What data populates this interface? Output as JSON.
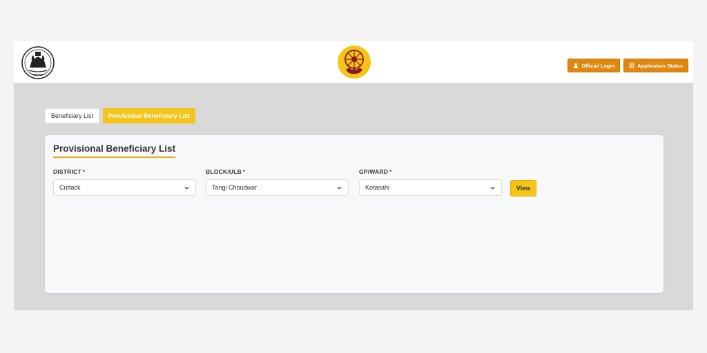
{
  "header": {
    "official_login_label": "Official Login",
    "application_status_label": "Application Status"
  },
  "tabs": [
    {
      "label": "Beneficiary List",
      "active": false
    },
    {
      "label": "Provisional Beneficiary List",
      "active": true
    }
  ],
  "card": {
    "title": "Provisional Beneficiary List",
    "fields": [
      {
        "label": "DISTRICT",
        "value": "Cuttack"
      },
      {
        "label": "BLOCK/ULB",
        "value": "Tangi Choudwar"
      },
      {
        "label": "GP/WARD",
        "value": "Kotasahi"
      }
    ],
    "required_mark": "*",
    "view_label": "View"
  },
  "colors": {
    "accent_orange": "#e0870f",
    "accent_yellow": "#f5c417",
    "page_bg": "#d9d9d9"
  },
  "icons": [
    "odisha-emblem-icon",
    "subhadra-logo-icon",
    "user-icon",
    "document-icon",
    "chevron-down-icon"
  ]
}
